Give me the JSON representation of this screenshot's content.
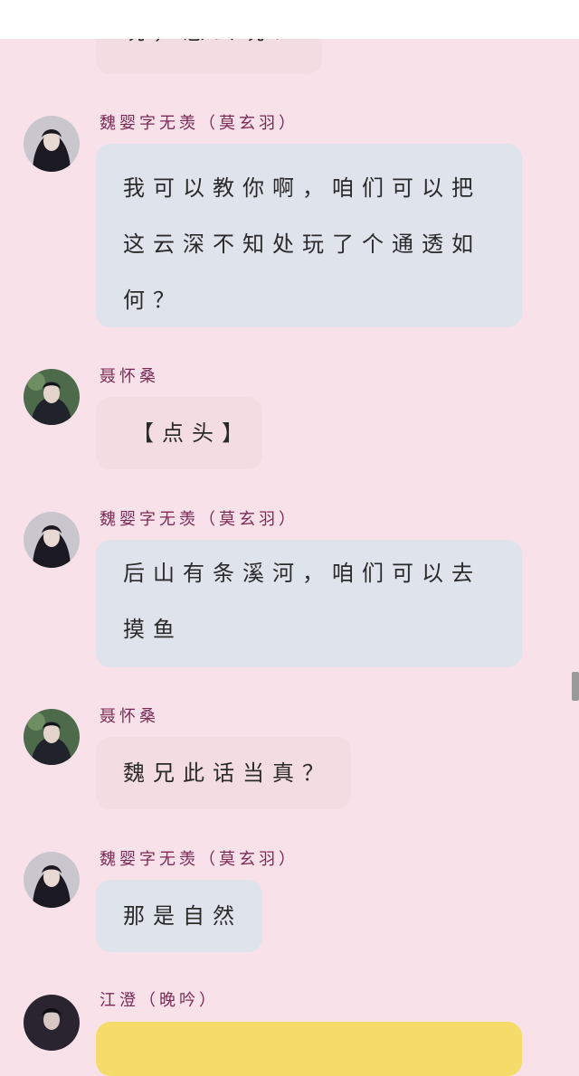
{
  "messages": [
    {
      "kind": "partial",
      "lines": [
        "玩，怎么玩？"
      ]
    },
    {
      "speaker": "魏婴字无羡（莫玄羽）",
      "avatar": "wei-ying-avatar",
      "lines": [
        "我可以教你啊，咱们可以把",
        "这云深不知处玩了个通透如",
        "何？"
      ]
    },
    {
      "speaker": "聂怀桑",
      "avatar": "nie-huaisang-avatar",
      "lines": [
        "【点头】"
      ]
    },
    {
      "speaker": "魏婴字无羡（莫玄羽）",
      "avatar": "wei-ying-avatar",
      "lines": [
        "后山有条溪河，咱们可以去",
        "摸鱼"
      ]
    },
    {
      "speaker": "聂怀桑",
      "avatar": "nie-huaisang-avatar",
      "lines": [
        "魏兄此话当真？"
      ]
    },
    {
      "speaker": "魏婴字无羡（莫玄羽）",
      "avatar": "wei-ying-avatar",
      "lines": [
        "那是自然"
      ]
    },
    {
      "speaker": "江澄（晚吟）",
      "avatar": "jiang-cheng-avatar",
      "lines": []
    }
  ],
  "colors": {
    "background": "#f9e1ea",
    "name_text": "#7a2a55",
    "bubble_blue": "#dfe3ec",
    "bubble_pink": "#f4dde2",
    "bubble_yellow": "#f5dc6a"
  }
}
